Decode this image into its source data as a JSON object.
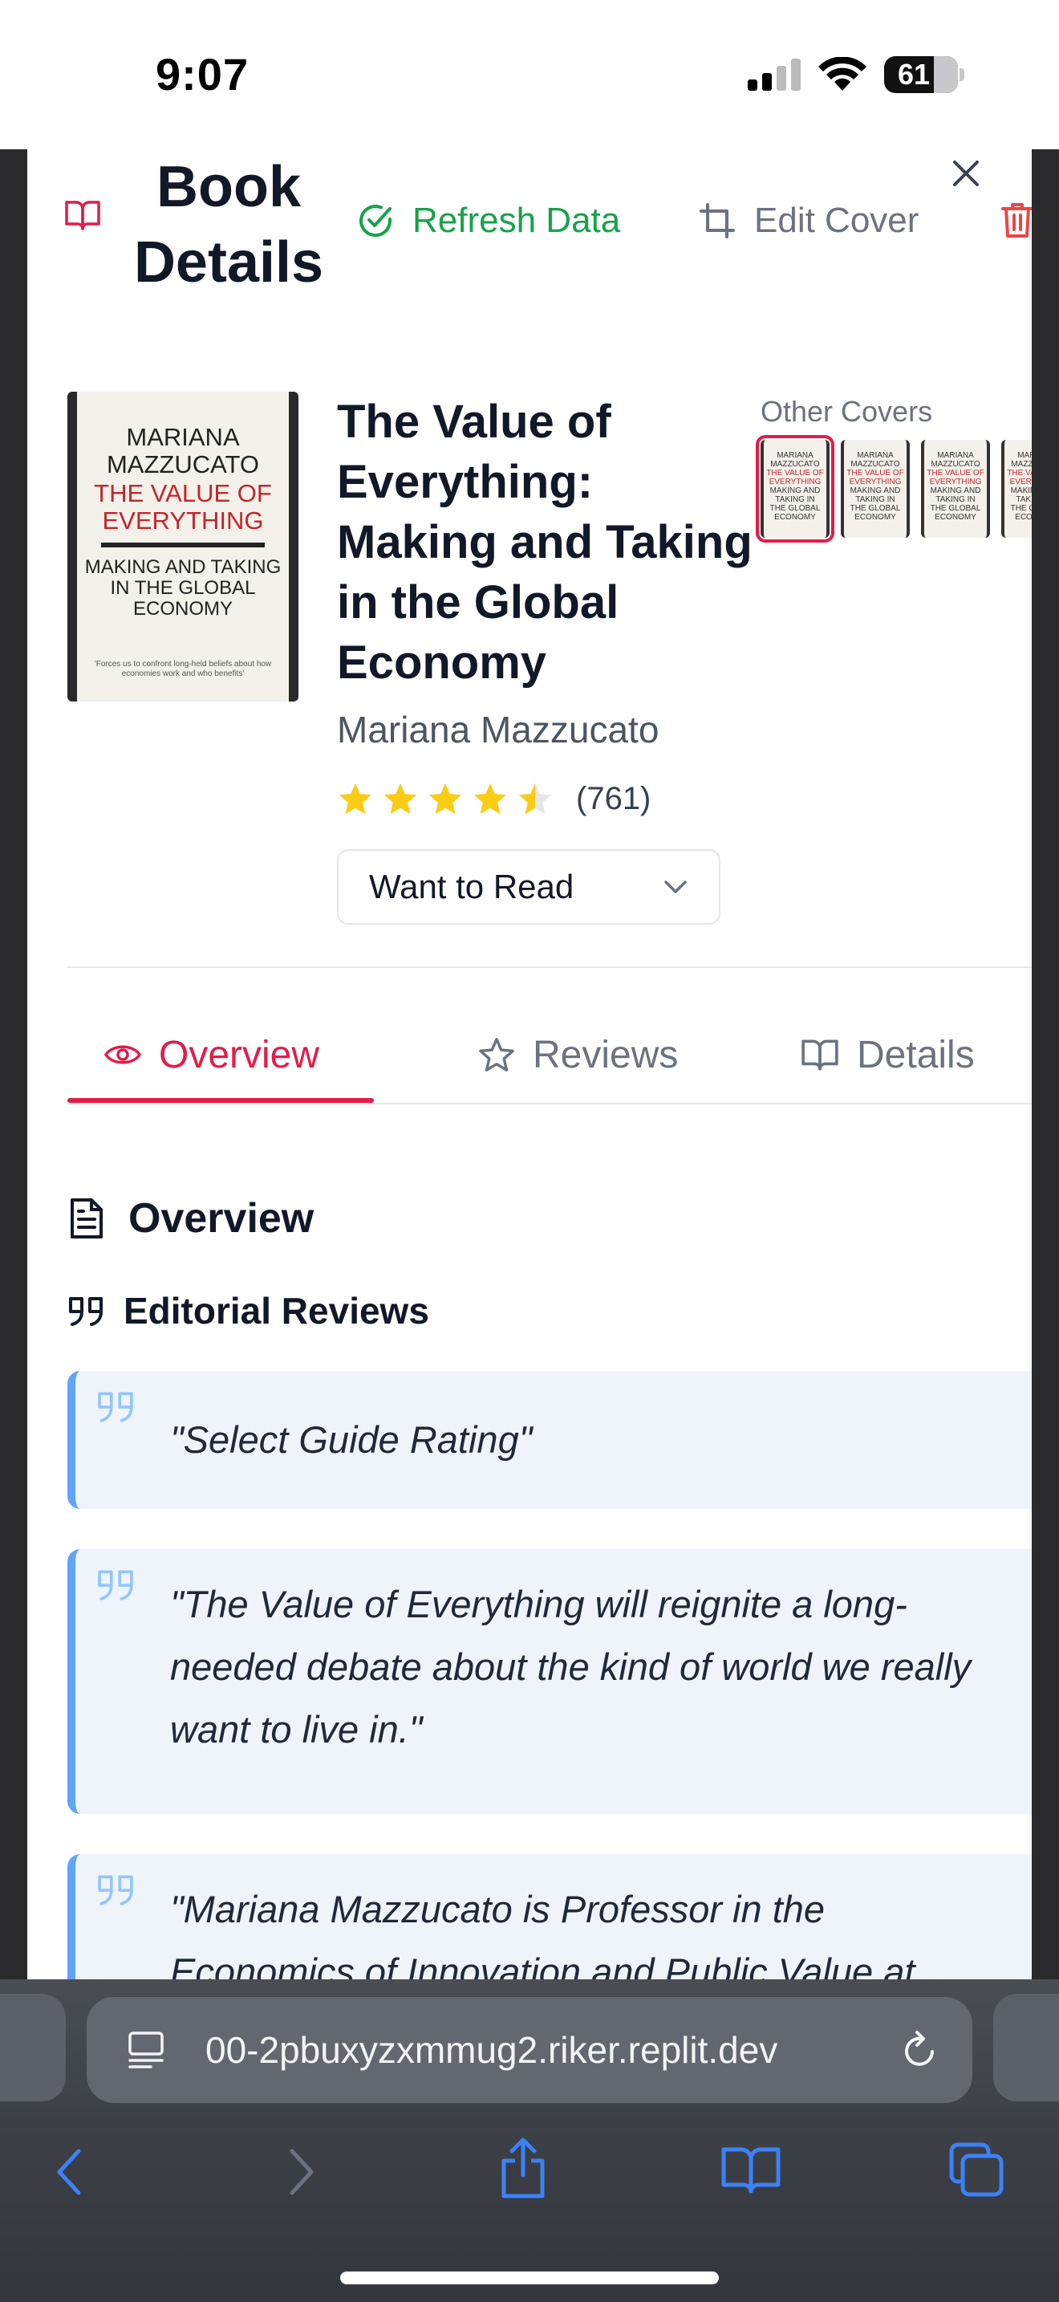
{
  "status_bar": {
    "time": "9:07",
    "battery": "61"
  },
  "header": {
    "title": "Book Details",
    "refresh_label": "Refresh Data",
    "edit_cover_label": "Edit Cover"
  },
  "cover": {
    "author_upper": "MARIANA MAZZUCATO",
    "title_upper": "THE VALUE OF EVERYTHING",
    "subtitle_upper": "MAKING AND TAKING IN THE GLOBAL ECONOMY",
    "quote": "'Forces us to confront long-held beliefs about how economies work and who benefits'"
  },
  "book": {
    "title": "The Value of Everything: Making and Taking in the Global Economy",
    "author": "Mariana Mazzucato",
    "rating": 4.5,
    "rating_count": "(761)",
    "status": "Want to Read"
  },
  "other_covers": {
    "label": "Other Covers",
    "count_visible": 4,
    "selected_index": 0
  },
  "tabs": [
    {
      "label": "Overview",
      "active": true
    },
    {
      "label": "Reviews",
      "active": false
    },
    {
      "label": "Details",
      "active": false
    }
  ],
  "overview": {
    "heading": "Overview",
    "editorial_heading": "Editorial Reviews",
    "reviews": [
      "\"Select Guide Rating\"",
      "\"The Value of Everything will reignite a long-needed debate about the kind of world we really want to live in.\"",
      "\"Mariana Mazzucato is Professor in the Economics of Innovation and Public Value at"
    ]
  },
  "browser": {
    "url": "00-2pbuxyzxmmug2.riker.replit.dev"
  },
  "colors": {
    "accent": "#e11d48",
    "success": "#16a34a",
    "quote_border": "#60a5fa",
    "star": "#facc15"
  }
}
